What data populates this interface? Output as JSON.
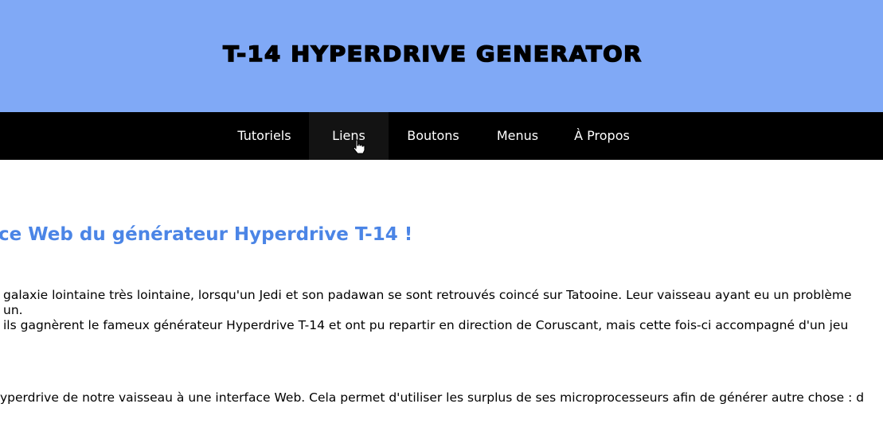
{
  "header": {
    "title": "T-14 HYPERDRIVE GENERATOR",
    "background_color": "#80a9f6"
  },
  "nav": {
    "items": [
      {
        "label": "Tutoriels"
      },
      {
        "label": "Liens",
        "state": "hovered"
      },
      {
        "label": "Boutons"
      },
      {
        "label": "Menus"
      },
      {
        "label": "À Propos"
      }
    ]
  },
  "main": {
    "heading": "ce Web du générateur Hyperdrive T-14 !",
    "heading_color": "#4b85e6",
    "intro_lines": [
      "galaxie lointaine très lointaine, lorsqu'un Jedi et son padawan se sont retrouvés coincé sur Tatooine. Leur vaisseau ayant eu un problème",
      "un.",
      "ils gagnèrent le fameux générateur Hyperdrive T-14 et ont pu repartir en direction de Coruscant, mais cette fois-ci accompagné d'un jeu"
    ],
    "second_paragraph": "yperdrive de notre vaisseau à une interface Web. Cela permet d'utiliser les surplus de ses microprocesseurs afin de générer autre chose : d"
  },
  "cursor": {
    "icon": "hand-pointer-icon"
  }
}
